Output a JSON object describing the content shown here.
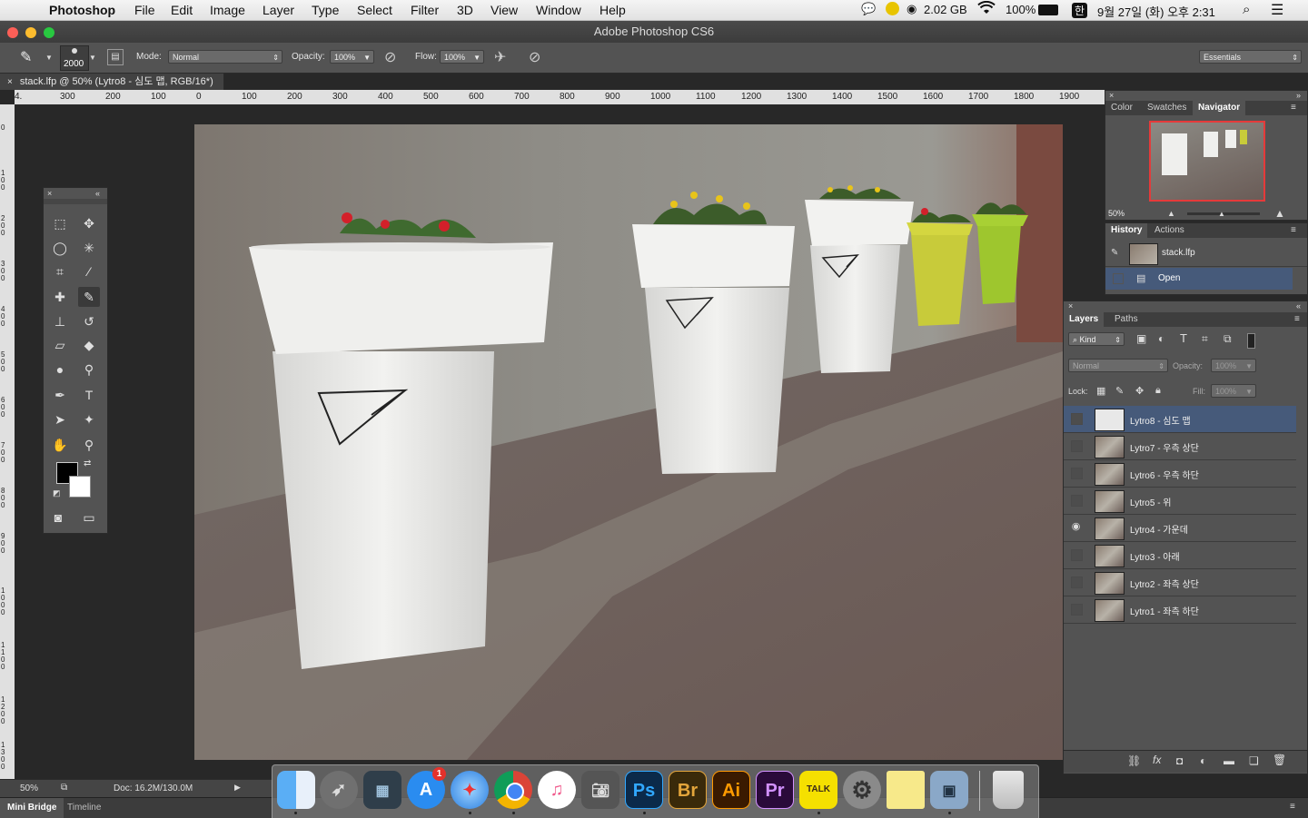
{
  "menubar": {
    "app_name": "Photoshop",
    "menus": [
      "File",
      "Edit",
      "Image",
      "Layer",
      "Type",
      "Select",
      "Filter",
      "3D",
      "View",
      "Window",
      "Help"
    ],
    "status": {
      "memory": "2.02 GB",
      "battery": "100%",
      "input_method": "한",
      "datetime": "9월 27일 (화) 오후 2:31"
    }
  },
  "window": {
    "title": "Adobe Photoshop CS6"
  },
  "options_bar": {
    "brush_size": "2000",
    "mode_label": "Mode:",
    "mode_value": "Normal",
    "opacity_label": "Opacity:",
    "opacity_value": "100%",
    "flow_label": "Flow:",
    "flow_value": "100%",
    "workspace": "Essentials"
  },
  "document": {
    "tab_title": "stack.lfp @ 50% (Lytro8 - 심도 맵, RGB/16*)",
    "ruler_h_ticks": [
      "4.",
      "300",
      "200",
      "100",
      "0",
      "100",
      "200",
      "300",
      "400",
      "500",
      "600",
      "700",
      "800",
      "900",
      "1000",
      "1100",
      "1200",
      "1300",
      "1400",
      "1500",
      "1600",
      "1700",
      "1800",
      "1900"
    ],
    "ruler_v_ticks": [
      "0",
      "100",
      "200",
      "300",
      "400",
      "500",
      "600",
      "700",
      "800",
      "900",
      "1000",
      "1100",
      "1200",
      "1300"
    ]
  },
  "status_bar": {
    "zoom": "50%",
    "doc_info": "Doc: 16.2M/130.0M"
  },
  "bottom_tabs": [
    "Mini Bridge",
    "Timeline"
  ],
  "navigator_panel": {
    "tabs": [
      "Color",
      "Swatches",
      "Navigator"
    ],
    "active_tab": "Navigator",
    "zoom": "50%"
  },
  "history_panel": {
    "tabs": [
      "History",
      "Actions"
    ],
    "active_tab": "History",
    "snapshot": "stack.lfp",
    "items": [
      "Open"
    ]
  },
  "layers_panel": {
    "tabs": [
      "Layers",
      "Paths"
    ],
    "active_tab": "Layers",
    "filter_kind": "Kind",
    "blend_mode": "Normal",
    "opacity_label": "Opacity:",
    "opacity_value": "100%",
    "lock_label": "Lock:",
    "fill_label": "Fill:",
    "fill_value": "100%",
    "layers": [
      {
        "name": "Lytro8 - 심도 맵",
        "visible": false,
        "selected": true
      },
      {
        "name": "Lytro7 - 우측 상단",
        "visible": false,
        "selected": false
      },
      {
        "name": "Lytro6 - 우측 하단",
        "visible": false,
        "selected": false
      },
      {
        "name": "Lytro5 - 위",
        "visible": false,
        "selected": false
      },
      {
        "name": "Lytro4 - 가운데",
        "visible": true,
        "selected": false
      },
      {
        "name": "Lytro3 - 아래",
        "visible": false,
        "selected": false
      },
      {
        "name": "Lytro2 - 좌측 상단",
        "visible": false,
        "selected": false
      },
      {
        "name": "Lytro1 - 좌측 하단",
        "visible": false,
        "selected": false
      }
    ]
  },
  "dock": {
    "apps": [
      {
        "name": "Finder",
        "label": "",
        "color": "#3d8ee6"
      },
      {
        "name": "Launchpad",
        "label": "",
        "color": "#6b6b6b"
      },
      {
        "name": "Mission Control",
        "label": "",
        "color": "#2f3e4a"
      },
      {
        "name": "App Store",
        "label": "A",
        "color": "#2a8cf0",
        "badge": "1"
      },
      {
        "name": "Safari",
        "label": "",
        "color": "#3aa0f0"
      },
      {
        "name": "Chrome",
        "label": "",
        "color": "#e8e8e8"
      },
      {
        "name": "iTunes",
        "label": "♫",
        "color": "#f05a8c"
      },
      {
        "name": "Image Capture",
        "label": "",
        "color": "#555555"
      },
      {
        "name": "Photoshop",
        "label": "Ps",
        "color": "#0b2a4a"
      },
      {
        "name": "Bridge",
        "label": "Br",
        "color": "#3a2a0a"
      },
      {
        "name": "Illustrator",
        "label": "Ai",
        "color": "#3a1a00"
      },
      {
        "name": "Premiere",
        "label": "Pr",
        "color": "#2a0a3a"
      },
      {
        "name": "KakaoTalk",
        "label": "TALK",
        "color": "#f5e000"
      },
      {
        "name": "System Preferences",
        "label": "⚙",
        "color": "#888888"
      },
      {
        "name": "Stickies",
        "label": "",
        "color": "#f7e98a"
      },
      {
        "name": "Preview",
        "label": "",
        "color": "#8aa8c8"
      },
      {
        "name": "Trash",
        "label": "",
        "color": "#cfcfcf"
      }
    ]
  }
}
